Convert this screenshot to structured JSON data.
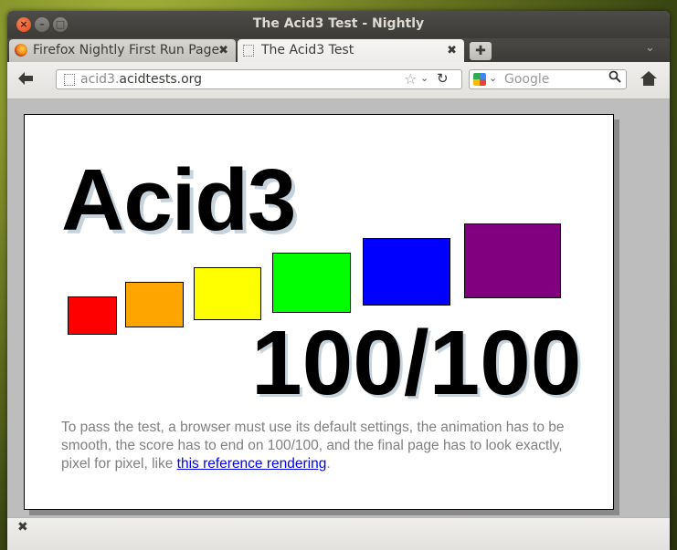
{
  "window": {
    "title": "The Acid3 Test - Nightly",
    "close_glyph": "×",
    "min_glyph": "–",
    "max_glyph": "□"
  },
  "tabs": [
    {
      "label": "Firefox Nightly First Run Page",
      "close_glyph": "✖",
      "favicon": "firefox-icon",
      "active": false
    },
    {
      "label": "The Acid3 Test",
      "close_glyph": "✖",
      "favicon": "page-icon",
      "active": true
    }
  ],
  "tabbar": {
    "new_tab_glyph": "✚",
    "list_glyph": "⌄"
  },
  "navbar": {
    "back_glyph": "🡄",
    "url_prefix": "acid3.",
    "url_domain": "acidtests.org",
    "star_glyph": "☆",
    "drop_glyph": "⌄",
    "reload_glyph": "↻",
    "search_drop_glyph": "⌄",
    "search_placeholder": "Google",
    "search_glyph": "🔍"
  },
  "page": {
    "heading": "Acid3",
    "score": "100/100",
    "description_text": "To pass the test, a browser must use its default settings, the animation has to be smooth, the score has to end on 100/100, and the final page has to look exactly, pixel for pixel, like ",
    "link_text": "this reference rendering",
    "description_end": ".",
    "box_colors": [
      "#ff0000",
      "#ffa500",
      "#ffff00",
      "#00ff00",
      "#0000ff",
      "#800080"
    ]
  },
  "statusbar": {
    "close_glyph": "✖"
  }
}
